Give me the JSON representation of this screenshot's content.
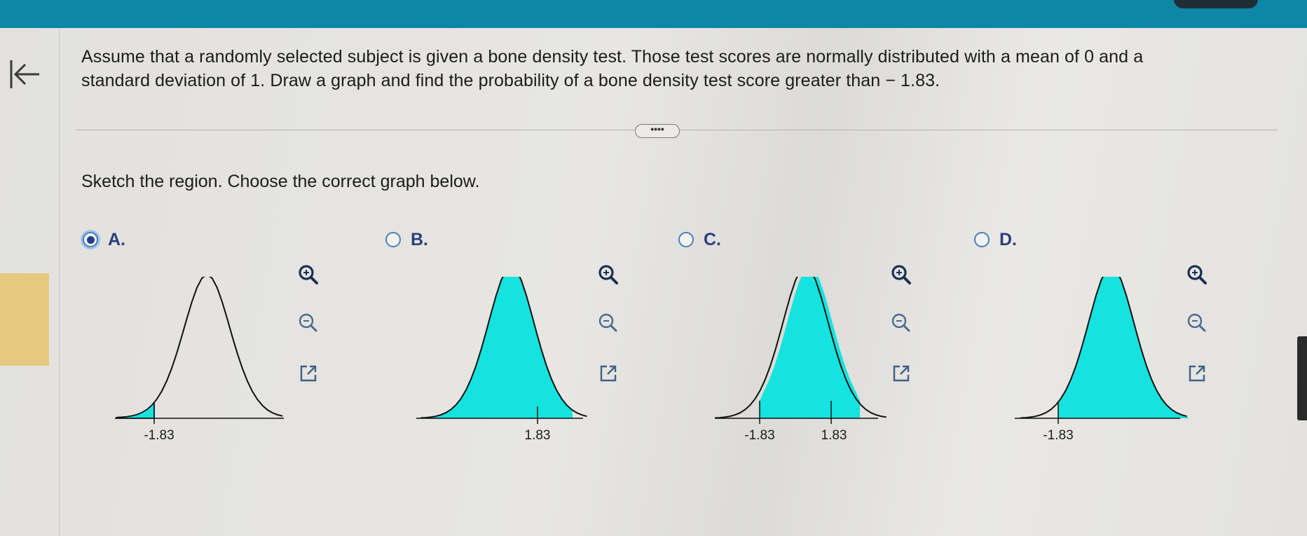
{
  "question": {
    "line1": "Assume that a randomly selected subject is given a bone density test. Those test scores are normally distributed with a mean of 0 and a",
    "line2": "standard deviation of 1. Draw a graph and find the probability of a bone density test score greater than − 1.83."
  },
  "more_button": {
    "label": "••••"
  },
  "instruction": "Sketch the region. Choose the correct graph below.",
  "colors": {
    "fill": "#14e3df",
    "topbar": "#0e86a6",
    "radio_selected": "#1f3f8a"
  },
  "options": [
    {
      "label": "A.",
      "selected": true,
      "shade": "left-tail",
      "ticks": [
        "-1.83"
      ]
    },
    {
      "label": "B.",
      "selected": false,
      "shade": "left-of",
      "ticks": [
        "1.83"
      ]
    },
    {
      "label": "C.",
      "selected": false,
      "shade": "between",
      "ticks": [
        "-1.83",
        "1.83"
      ]
    },
    {
      "label": "D.",
      "selected": false,
      "shade": "right-of",
      "ticks": [
        "-1.83"
      ]
    }
  ],
  "icons": {
    "zoom_in": "zoom-in-icon",
    "zoom_out": "zoom-out-icon",
    "popout": "external-link-icon",
    "back": "back-to-start-icon"
  }
}
